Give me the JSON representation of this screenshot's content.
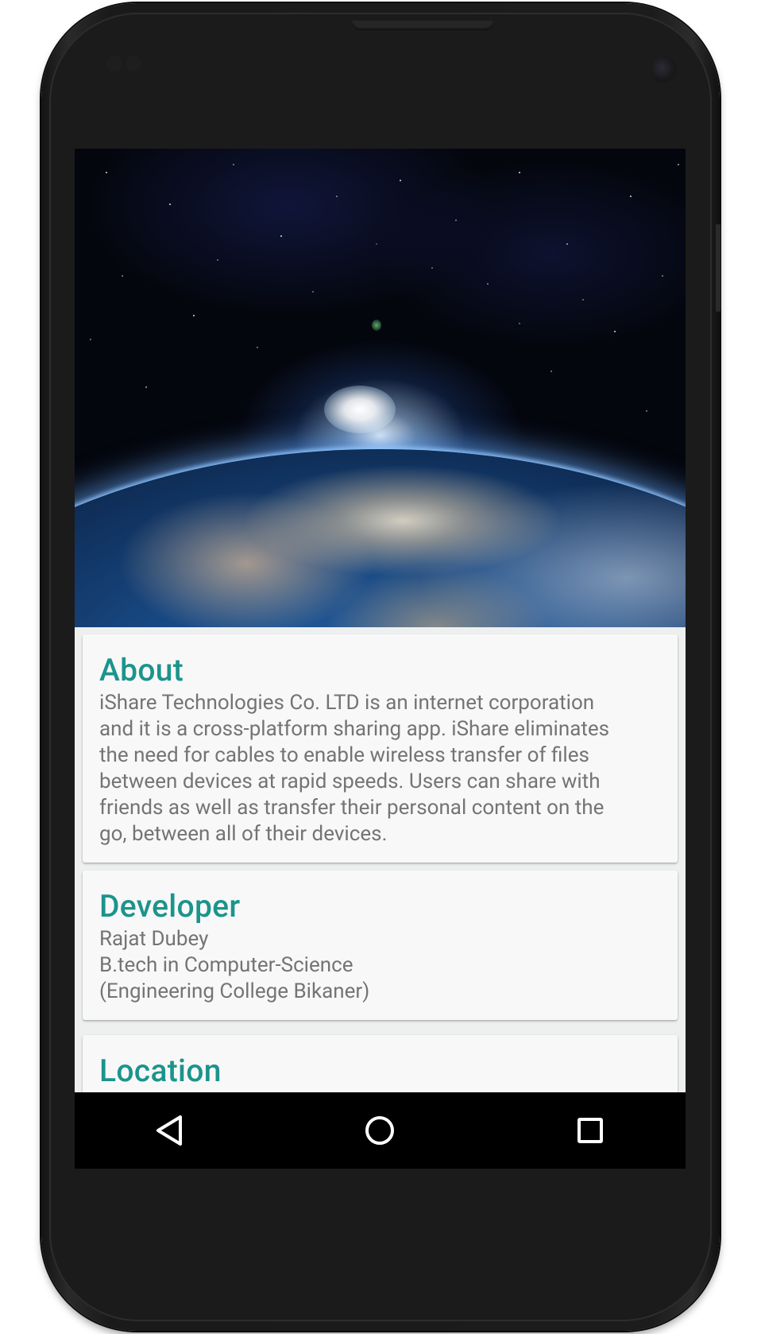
{
  "about": {
    "title": "About",
    "lines": [
      "iShare Technologies Co. LTD is an internet corporation",
      "and it is a cross-platform sharing app. iShare eliminates",
      "the need for cables to enable wireless transfer of files",
      "between devices at rapid speeds. Users can share with",
      "friends as well as transfer their personal content on the",
      "go, between all of their devices."
    ]
  },
  "developer": {
    "title": "Developer",
    "lines": [
      "Rajat Dubey",
      "B.tech in Computer-Science",
      "(Engineering College Bikaner)"
    ]
  },
  "location": {
    "title": "Location"
  },
  "navbar": {
    "back_icon": "back-triangle-icon",
    "home_icon": "home-circle-icon",
    "recents_icon": "recents-square-icon"
  },
  "colors": {
    "title_teal": "#1b948c",
    "body_gray": "#747474",
    "card_bg": "#f8f8f8",
    "navbar_bg": "#000000"
  }
}
